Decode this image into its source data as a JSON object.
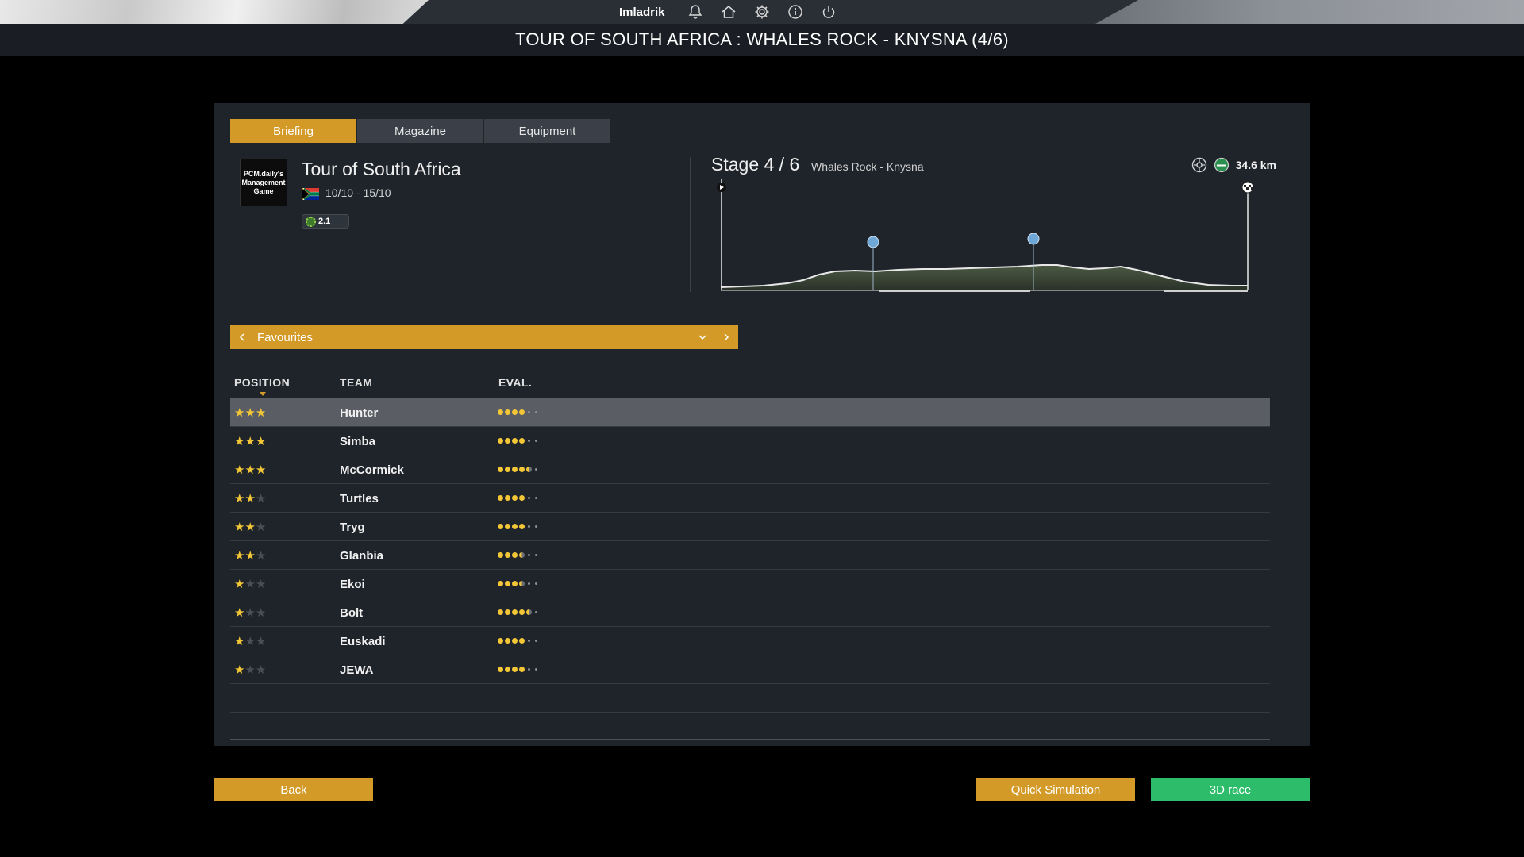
{
  "topbar": {
    "username": "Imladrik",
    "icons": [
      "bell-icon",
      "home-icon",
      "gear-icon",
      "info-icon",
      "power-icon"
    ]
  },
  "page_title": "TOUR OF SOUTH AFRICA : WHALES ROCK - KNYSNA (4/6)",
  "tabs": [
    {
      "label": "Briefing",
      "active": true
    },
    {
      "label": "Magazine",
      "active": false
    },
    {
      "label": "Equipment",
      "active": false
    }
  ],
  "race": {
    "logo_text": "PCM.daily's Management Game",
    "name": "Tour of South Africa",
    "dates": "10/10 - 15/10",
    "class": "2.1"
  },
  "stage": {
    "title": "Stage 4 / 6",
    "route": "Whales Rock - Knysna",
    "distance": "34.6 km"
  },
  "selector": {
    "label": "Favourites"
  },
  "table": {
    "headers": {
      "position": "POSITION",
      "team": "TEAM",
      "eval": "EVAL."
    },
    "rows": [
      {
        "team": "Hunter",
        "stars": 3,
        "eval": 4.0,
        "selected": true
      },
      {
        "team": "Simba",
        "stars": 3,
        "eval": 4.0,
        "selected": false
      },
      {
        "team": "McCormick",
        "stars": 3,
        "eval": 4.5,
        "selected": false
      },
      {
        "team": "Turtles",
        "stars": 2,
        "eval": 4.0,
        "selected": false
      },
      {
        "team": "Tryg",
        "stars": 2,
        "eval": 4.0,
        "selected": false
      },
      {
        "team": "Glanbia",
        "stars": 2,
        "eval": 3.5,
        "selected": false
      },
      {
        "team": "Ekoi",
        "stars": 1,
        "eval": 3.5,
        "selected": false
      },
      {
        "team": "Bolt",
        "stars": 1,
        "eval": 4.5,
        "selected": false
      },
      {
        "team": "Euskadi",
        "stars": 1,
        "eval": 4.0,
        "selected": false
      },
      {
        "team": "JEWA",
        "stars": 1,
        "eval": 4.0,
        "selected": false
      }
    ]
  },
  "buttons": {
    "back": "Back",
    "quick": "Quick Simulation",
    "race3d": "3D race"
  },
  "colors": {
    "accent": "#d39a28",
    "green": "#2dbd6a",
    "star": "#f2c636"
  }
}
